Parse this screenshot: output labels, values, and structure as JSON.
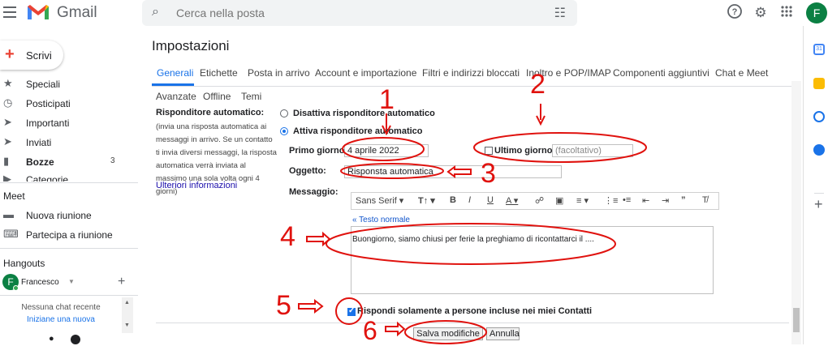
{
  "header": {
    "logo_text": "Gmail",
    "search_placeholder": "Cerca nella posta",
    "avatar_letter": "F",
    "icons": [
      "menu-icon",
      "gmail-logo",
      "search-icon",
      "search-filter-icon",
      "help-icon",
      "gear-icon",
      "apps-icon"
    ]
  },
  "sidebar": {
    "compose_label": "Scrivi",
    "items": [
      {
        "label": "Speciali",
        "icon": "star-icon",
        "count": ""
      },
      {
        "label": "Posticipati",
        "icon": "clock-icon",
        "count": ""
      },
      {
        "label": "Importanti",
        "icon": "important-icon",
        "count": ""
      },
      {
        "label": "Inviati",
        "icon": "send-icon",
        "count": ""
      },
      {
        "label": "Bozze",
        "icon": "draft-icon",
        "count": "3"
      },
      {
        "label": "Categorie",
        "icon": "tag-icon",
        "count": ""
      }
    ],
    "meet_title": "Meet",
    "meet_items": [
      {
        "label": "Nuova riunione",
        "icon": "video-icon"
      },
      {
        "label": "Partecipa a riunione",
        "icon": "keyboard-icon"
      }
    ],
    "hangouts_title": "Hangouts",
    "hangouts_user": "Francesco",
    "hangouts_user_letter": "F",
    "no_chat": "Nessuna chat recente",
    "start_chat": "Iniziane una nuova"
  },
  "settings": {
    "title": "Impostazioni",
    "tabs": [
      "Generali",
      "Etichette",
      "Posta in arrivo",
      "Account e importazione",
      "Filtri e indirizzi bloccati",
      "Inoltro e POP/IMAP",
      "Componenti aggiuntivi",
      "Chat e Meet"
    ],
    "tabs_row2": [
      "Avanzate",
      "Offline",
      "Temi"
    ],
    "active_tab": "Generali"
  },
  "auto_reply": {
    "title": "Risponditore automatico:",
    "description": "(invia una risposta automatica ai messaggi in arrivo. Se un contatto ti invia diversi messaggi, la risposta automatica verrà inviata al massimo una sola volta ogni 4 giorni)",
    "more_info": "Ulteriori informazioni",
    "option_off": "Disattiva risponditore automatico",
    "option_on": "Attiva risponditore automatico",
    "selected": "on",
    "first_day_label": "Primo giorno:",
    "first_day_value": "4 aprile 2022",
    "last_day_label": "Ultimo giorno:",
    "last_day_placeholder": "(facoltativo)",
    "last_day_checked": false,
    "subject_label": "Oggetto:",
    "subject_value": "Risponsta automatica",
    "message_label": "Messaggio:",
    "plain_text_link": "« Testo normale",
    "message_text": "Buongiorno, siamo chiusi per ferie la preghiamo di ricontattarci il ....",
    "contacts_only_label": "Rispondi solamente a persone incluse nei miei Contatti",
    "contacts_only_checked": true,
    "save_button": "Salva modifiche",
    "cancel_button": "Annulla"
  },
  "toolbar": {
    "font": "Sans Serif",
    "items": [
      "font-size-icon",
      "bold-icon",
      "italic-icon",
      "underline-icon",
      "text-color-icon",
      "link-icon",
      "image-icon",
      "align-icon",
      "numbered-list-icon",
      "bulleted-list-icon",
      "indent-less-icon",
      "indent-more-icon",
      "quote-icon",
      "remove-format-icon"
    ]
  },
  "annotations": [
    "1",
    "2",
    "3",
    "4",
    "5",
    "6"
  ],
  "colors": {
    "accent": "#1a73e8",
    "annotation": "#e0120e",
    "avatar": "#0b8043"
  }
}
